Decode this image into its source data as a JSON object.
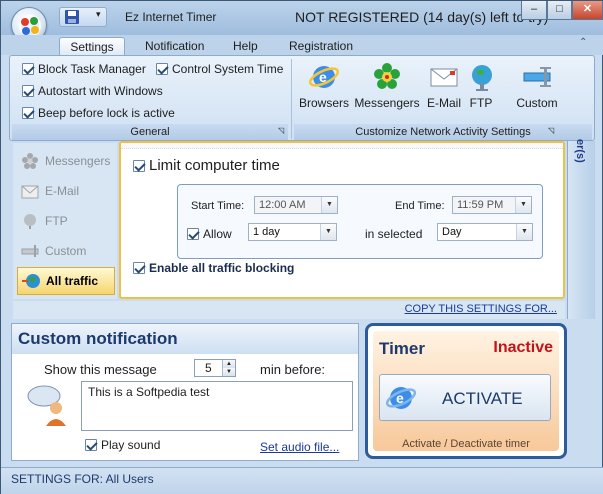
{
  "titlebar": {
    "app_title": "Ez Internet Timer",
    "registration_status": "NOT REGISTERED (14 day(s) left to try)",
    "minimize": "–",
    "maximize": "□",
    "close": "✕"
  },
  "ribbon": {
    "tabs": [
      {
        "label": "Settings"
      },
      {
        "label": "Notification"
      },
      {
        "label": "Help"
      },
      {
        "label": "Registration"
      }
    ],
    "general": {
      "label": "General",
      "options": [
        {
          "label": "Block Task Manager"
        },
        {
          "label": "Control System Time"
        },
        {
          "label": "Autostart with Windows"
        },
        {
          "label": "Beep before lock is active"
        }
      ]
    },
    "network": {
      "label": "Customize Network Activity Settings",
      "buttons": [
        {
          "label": "Browsers",
          "icon": "ie-icon"
        },
        {
          "label": "Messengers",
          "icon": "flower-icon"
        },
        {
          "label": "E-Mail",
          "icon": "email-icon"
        },
        {
          "label": "FTP",
          "icon": "globe-icon"
        },
        {
          "label": "Custom",
          "icon": "custom-icon"
        }
      ]
    }
  },
  "nav": {
    "items": [
      {
        "label": "Messengers"
      },
      {
        "label": "E-Mail"
      },
      {
        "label": "FTP"
      },
      {
        "label": "Custom"
      },
      {
        "label": "All traffic"
      }
    ]
  },
  "settings_panel": {
    "limit_label": "Limit computer time",
    "start_time_label": "Start Time:",
    "start_time_value": "12:00 AM",
    "end_time_label": "End Time:",
    "end_time_value": "11:59 PM",
    "allow_label": "Allow",
    "allow_value": "1 day",
    "in_selected_label": "in selected",
    "period_value": "Day",
    "block_all_label": "Enable all traffic blocking",
    "copy_link": "COPY THIS SETTINGS FOR...",
    "side_label": "er(s)"
  },
  "notification": {
    "title": "Custom notification",
    "show_label": "Show this message",
    "minutes_value": "5",
    "min_before_label": "min before:",
    "message_text": "This is a Softpedia test",
    "play_sound_label": "Play sound",
    "audio_link": "Set audio file..."
  },
  "timer": {
    "title": "Timer",
    "status": "Inactive",
    "activate_label": "ACTIVATE",
    "footer": "Activate / Deactivate timer"
  },
  "statusbar": {
    "text": "SETTINGS FOR: All Users"
  },
  "colors": {
    "accent_blue": "#1c3a6e",
    "inactive_red": "#c0141c",
    "selected_nav": "#f6d56e"
  }
}
